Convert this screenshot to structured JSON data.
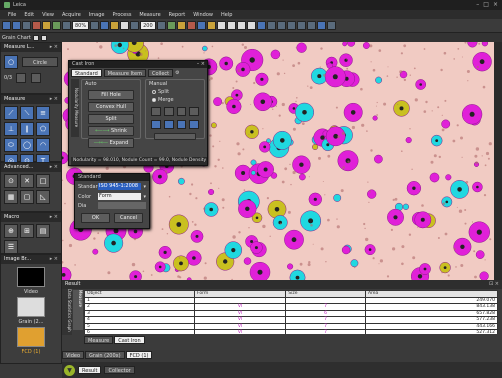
{
  "app": {
    "title": "Leica"
  },
  "menu": [
    "File",
    "Edit",
    "View",
    "Acquire",
    "Image",
    "Process",
    "Measure",
    "Report",
    "Window",
    "Help"
  ],
  "toolbar": {
    "zoom": "80%",
    "count": "200"
  },
  "subtoolbar": {
    "label": "Grain Chart"
  },
  "measure_panel": {
    "title": "Measure L...",
    "circle_label": "Circle",
    "counter": "0/3"
  },
  "measure_tools": {
    "title": "Measure"
  },
  "advanced": {
    "title": "Advanced..."
  },
  "macro": {
    "title": "Macro"
  },
  "image_browser": {
    "title": "Image Br...",
    "items": [
      {
        "label": "Video"
      },
      {
        "label": "Grain (2..."
      },
      {
        "label": "FCD (1)"
      }
    ]
  },
  "cast_iron_dialog": {
    "title": "Cast Iron",
    "tabs": [
      "Standard",
      "Measure Item",
      "Collect"
    ],
    "side_tabs": [
      "Nodularity",
      "Measure"
    ],
    "auto_label": "Auto",
    "manual_label": "Manual",
    "auto_buttons": [
      "Fill Hole",
      "Convex Hull",
      "Split",
      "Shrink",
      "Expand"
    ],
    "radio_split": "Split",
    "radio_merge": "Merge",
    "status": "Nodularity = 98.010, Nodule Count = 99.0, Nodule Density = 8"
  },
  "standard_dialog": {
    "title": "Standard",
    "standard_label": "Standard",
    "standard_value": "ISO 945-1:2008",
    "color_label": "Color",
    "color_value": "Form",
    "dia_label": "Dia",
    "ok": "OK",
    "cancel": "Cancel"
  },
  "result": {
    "title": "Result",
    "side_tabs": [
      "Data",
      "Statistics",
      "Graph",
      "Measure"
    ],
    "columns": [
      "Object",
      "Form",
      "Size",
      "Area"
    ],
    "rows": [
      [
        "1",
        "",
        "",
        "249.070"
      ],
      [
        "2",
        "VI",
        "7",
        "843.138"
      ],
      [
        "3",
        "VI",
        "6",
        "657.828"
      ],
      [
        "4",
        "VI",
        "7",
        "577.238"
      ],
      [
        "5",
        "VI",
        "7",
        "443.166"
      ],
      [
        "6",
        "VI",
        "7",
        "527.312"
      ]
    ],
    "bottom_tabs": [
      "Measure",
      "Cast Iron"
    ],
    "doc_tabs": [
      "Video",
      "Grain (200x)",
      "FCD (1)"
    ],
    "footer_tabs": [
      "Result",
      "Collector"
    ]
  },
  "colors": {
    "accent": "#4a74b6",
    "magenta": "#e020d8",
    "cyan": "#20d8e0",
    "yellow": "#c9c020",
    "background": "#f1cbc3"
  }
}
